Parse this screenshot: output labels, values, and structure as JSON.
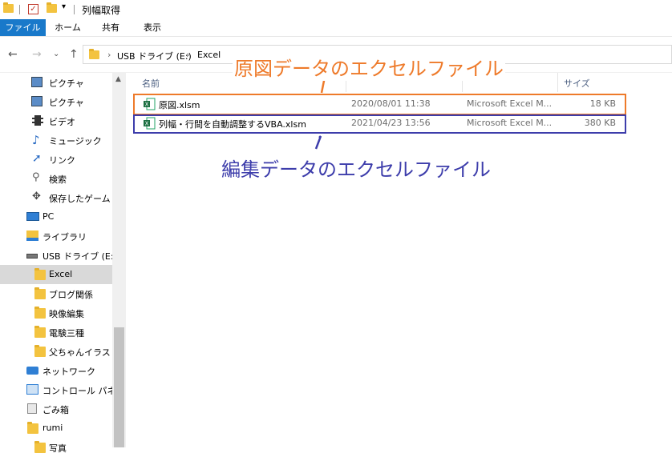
{
  "window": {
    "title": "列幅取得"
  },
  "ribbon": {
    "tabs": [
      "ファイル",
      "ホーム",
      "共有",
      "表示"
    ]
  },
  "address": {
    "segments": [
      "USB ドライブ (E:)",
      "Excel"
    ]
  },
  "navpane": {
    "items": [
      {
        "label": "ピクチャ",
        "icon": "pictures-icon"
      },
      {
        "label": "ピクチャ",
        "icon": "pictures-icon"
      },
      {
        "label": "ビデオ",
        "icon": "video-icon"
      },
      {
        "label": "ミュージック",
        "icon": "music-icon"
      },
      {
        "label": "リンク",
        "icon": "link-icon"
      },
      {
        "label": "検索",
        "icon": "search-icon"
      },
      {
        "label": "保存したゲーム",
        "icon": "game-icon"
      },
      {
        "label": "PC",
        "icon": "pc-icon"
      },
      {
        "label": "ライブラリ",
        "icon": "library-icon"
      },
      {
        "label": "USB ドライブ (E:)",
        "icon": "usb-drive-icon"
      },
      {
        "label": "Excel",
        "icon": "folder-icon"
      },
      {
        "label": "ブログ関係",
        "icon": "folder-icon"
      },
      {
        "label": "映像編集",
        "icon": "folder-icon"
      },
      {
        "label": "電験三種",
        "icon": "folder-icon"
      },
      {
        "label": "父ちゃんイラスト",
        "icon": "folder-icon"
      },
      {
        "label": "ネットワーク",
        "icon": "network-icon"
      },
      {
        "label": "コントロール パネル",
        "icon": "control-panel-icon"
      },
      {
        "label": "ごみ箱",
        "icon": "recycle-bin-icon"
      },
      {
        "label": "rumi",
        "icon": "folder-icon"
      },
      {
        "label": "写真",
        "icon": "folder-icon"
      }
    ]
  },
  "filelist": {
    "columns": {
      "name": "名前",
      "size": "サイズ"
    },
    "rows": [
      {
        "name": "原図.xlsm",
        "date": "2020/08/01 11:38",
        "type": "Microsoft Excel M...",
        "size": "18 KB"
      },
      {
        "name": "列幅・行間を自動調整するVBA.xlsm",
        "date": "2021/04/23 13:56",
        "type": "Microsoft Excel M...",
        "size": "380 KB"
      }
    ]
  },
  "annotations": {
    "original": "原図データのエクセルファイル",
    "edited": "編集データのエクセルファイル"
  },
  "colors": {
    "orange": "#ee7a2a",
    "blue": "#3d3dab",
    "file_tab": "#1979ca"
  }
}
